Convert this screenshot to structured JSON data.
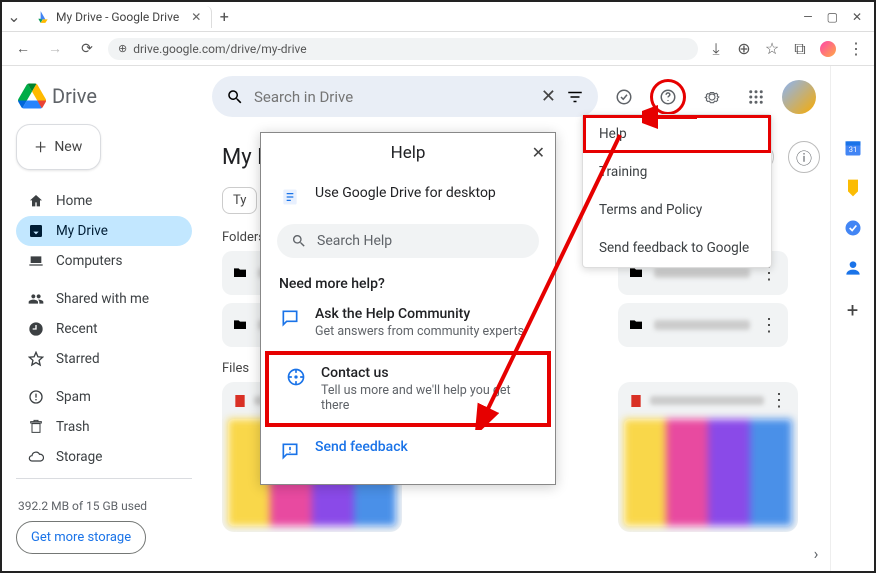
{
  "browser": {
    "tab_title": "My Drive - Google Drive",
    "url": "drive.google.com/drive/my-drive"
  },
  "app": {
    "logo_text": "Drive",
    "new_button": "New",
    "search_placeholder": "Search in Drive"
  },
  "sidebar": {
    "items": [
      {
        "label": "Home",
        "icon": "home"
      },
      {
        "label": "My Drive",
        "icon": "drive"
      },
      {
        "label": "Computers",
        "icon": "computer"
      }
    ],
    "group2": [
      {
        "label": "Shared with me",
        "icon": "people"
      },
      {
        "label": "Recent",
        "icon": "clock"
      },
      {
        "label": "Starred",
        "icon": "star"
      }
    ],
    "group3": [
      {
        "label": "Spam",
        "icon": "spam"
      },
      {
        "label": "Trash",
        "icon": "trash"
      },
      {
        "label": "Storage",
        "icon": "cloud"
      }
    ],
    "storage_used": "392.2 MB of 15 GB used",
    "storage_button": "Get more storage"
  },
  "page": {
    "title": "My Drive",
    "type_chip": "Ty",
    "section_folders": "Folders",
    "section_files": "Files"
  },
  "help_menu": {
    "items": [
      "Help",
      "Training",
      "Terms and Policy",
      "Send feedback to Google"
    ]
  },
  "help_panel": {
    "title": "Help",
    "desktop_row": "Use Google Drive for desktop",
    "search_placeholder": "Search Help",
    "need_more": "Need more help?",
    "community_title": "Ask the Help Community",
    "community_sub": "Get answers from community experts",
    "contact_title": "Contact us",
    "contact_sub": "Tell us more and we'll help you get there",
    "feedback": "Send feedback"
  }
}
